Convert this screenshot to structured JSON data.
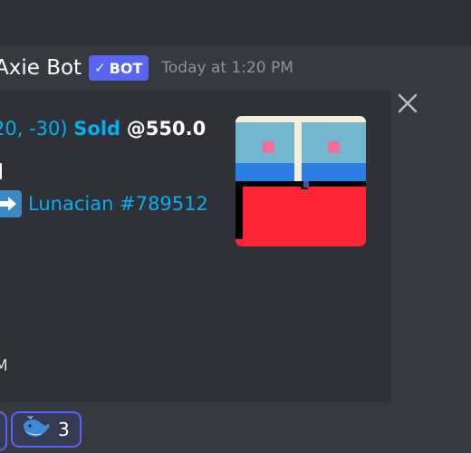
{
  "message": {
    "author": "Axie Bot",
    "bot_tag": "BOT",
    "timestamp": "Today at 1:20 PM"
  },
  "embed": {
    "title_coords": "20, -30)",
    "title_sold": "Sold",
    "title_price": "@550.0",
    "recipient_icon": "right-arrow-icon",
    "recipient": "Lunacian #789512",
    "footer_fragment": "M",
    "close_icon": "close-icon"
  },
  "reactions": [
    {
      "emoji": "whale-icon",
      "count": "3"
    }
  ],
  "colors": {
    "background": "#36393f",
    "embed_bg": "#2f3136",
    "link": "#00b0f4",
    "bot_tag": "#5865f2",
    "land_red": "#ff2436",
    "land_sky": "#72b7cf",
    "land_blue": "#2a7de2"
  }
}
